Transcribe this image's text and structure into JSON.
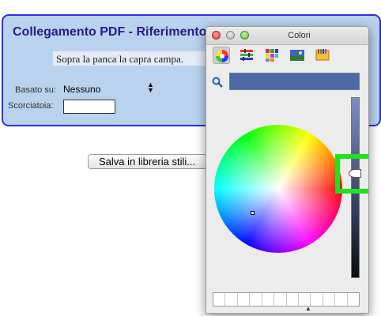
{
  "style_panel": {
    "title": "Collegamento PDF - Riferimento",
    "preview_text": "Sopra la panca la capra campa.",
    "based_on_label": "Basato su:",
    "based_on_value": "Nessuno",
    "shortcut_label": "Scorciatoia:",
    "shortcut_value": ""
  },
  "save_button_label": "Salva in libreria stili...",
  "color_window": {
    "title": "Colori",
    "toolbar_tools": [
      "color-wheel-icon",
      "color-sliders-icon",
      "color-palettes-icon",
      "image-palettes-icon",
      "crayons-icon"
    ],
    "selected_tool": "color-wheel-icon",
    "current_color": "#4b6aa6",
    "brightness_level": 0.4,
    "swatch_count": 12
  },
  "highlight_color": "#1ee21e"
}
